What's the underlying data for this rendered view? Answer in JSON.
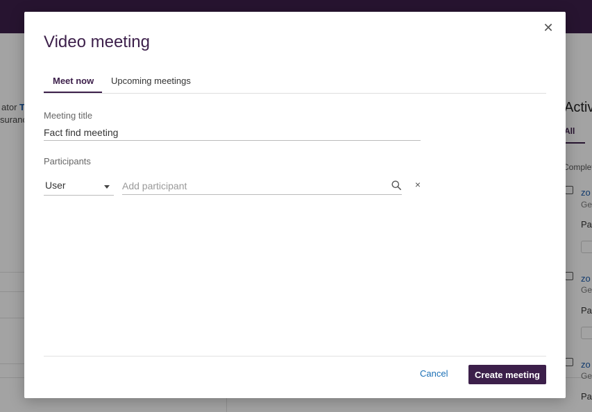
{
  "background": {
    "left_text_1": "ator",
    "left_link_1": "T",
    "left_text_2": "surance",
    "activities_title": "Activities",
    "tab_all": "All",
    "completed": "Completed",
    "cards": [
      {
        "title": "zo",
        "sub": "Ge",
        "pa": "Pa"
      },
      {
        "title": "zo",
        "sub": "Ge",
        "pa": "Pa"
      },
      {
        "title": "zo",
        "sub": "Ge",
        "pa": "Pa"
      }
    ]
  },
  "modal": {
    "title": "Video meeting",
    "close_icon": "close-icon",
    "tabs": [
      {
        "label": "Meet now",
        "active": true
      },
      {
        "label": "Upcoming meetings",
        "active": false
      }
    ],
    "meeting_title_label": "Meeting title",
    "meeting_title_value": "Fact find meeting",
    "participants_label": "Participants",
    "participant_type": "User",
    "participant_placeholder": "Add participant",
    "cancel_label": "Cancel",
    "create_label": "Create meeting"
  },
  "colors": {
    "brand": "#3c1f4a",
    "link": "#1a6fb5"
  }
}
